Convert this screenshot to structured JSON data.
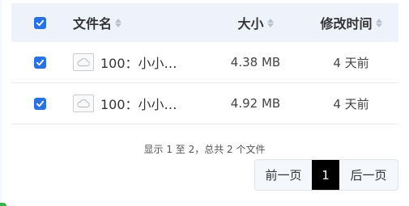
{
  "table": {
    "header": {
      "name": "文件名",
      "size": "大小",
      "time": "修改时间"
    },
    "rows": [
      {
        "name": "100：小小…",
        "size": "4.38 MB",
        "time": "4 天前",
        "checked": true
      },
      {
        "name": "100：小小…",
        "size": "4.92 MB",
        "time": "4 天前",
        "checked": true
      }
    ]
  },
  "summary": "显示 1 至 2，总共 2 个文件",
  "pagination": {
    "prev": "前一页",
    "current": "1",
    "next": "后一页"
  },
  "colors": {
    "accent": "#2a72e2",
    "header_bg": "#eef3fb",
    "current_page_bg": "#000000"
  },
  "icons": {
    "check": "checkmark-icon",
    "sort": "sort-icon",
    "file": "cloud-file-icon"
  }
}
